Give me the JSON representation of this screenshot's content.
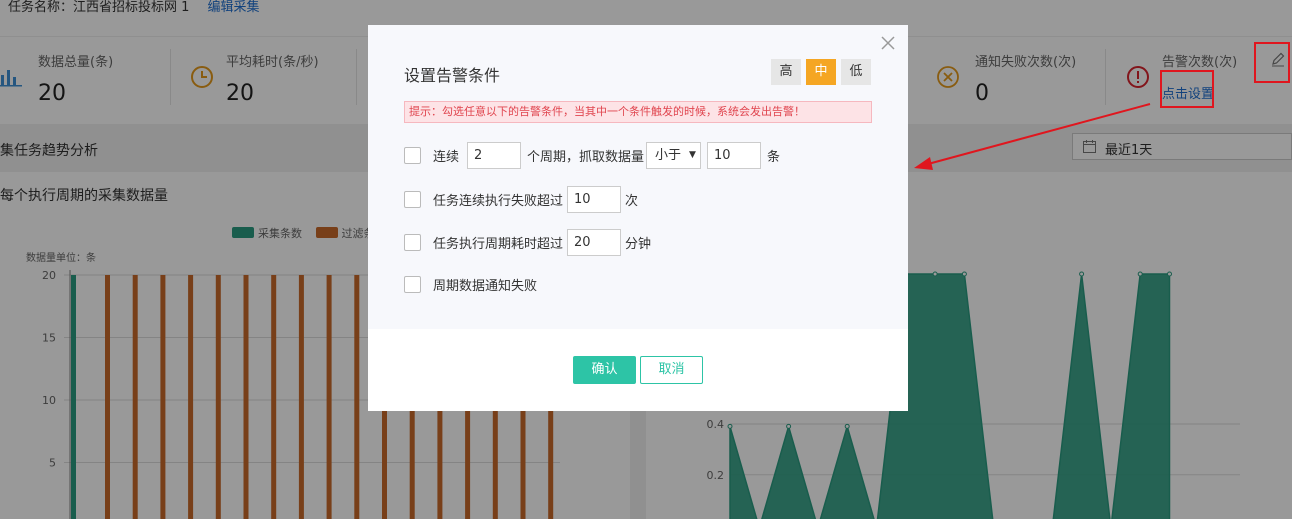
{
  "header": {
    "task_label": "任务名称：江西省招标投标网 1",
    "edit_link": "编辑采集"
  },
  "stats": {
    "total": {
      "title": "数据总量(条)",
      "value": "20"
    },
    "avg_time": {
      "title": "平均耗时(条/秒)",
      "value": "20"
    },
    "notify_fail": {
      "title": "通知失败次数(次)",
      "value": "0"
    },
    "alert": {
      "title": "告警次数(次)",
      "link": "点击设置"
    }
  },
  "section": {
    "title": "集任务趋势分析",
    "date_range": "最近1天"
  },
  "left_chart": {
    "title": "每个执行周期的采集数据量",
    "unit": "数据量单位：条",
    "legend": [
      "采集条数",
      "过滤条"
    ],
    "y_ticks": [
      "20",
      "15",
      "10",
      "5"
    ]
  },
  "right_chart": {
    "y_ticks": [
      "0.4",
      "0.2"
    ]
  },
  "chart_data": [
    {
      "type": "bar",
      "series": [
        {
          "name": "采集条数",
          "values": [
            20
          ]
        },
        {
          "name": "过滤条",
          "values": [
            20,
            20,
            20,
            20,
            20,
            20,
            20,
            20,
            20,
            20,
            20,
            20,
            20,
            20,
            20,
            20,
            20
          ]
        }
      ],
      "ylim": [
        0,
        20
      ],
      "colors": {
        "collected": "#2a9b80",
        "filtered": "#c8692a"
      }
    },
    {
      "type": "area",
      "values": [
        0.4,
        0,
        0.4,
        0,
        0.4,
        0,
        1,
        1,
        1,
        0,
        0,
        0,
        1,
        0,
        1,
        1
      ],
      "ylim": [
        0,
        1
      ],
      "color": "#2a9b80"
    }
  ],
  "modal": {
    "title": "设置告警条件",
    "levels": [
      "高",
      "中",
      "低"
    ],
    "active_level": "中",
    "tip": "提示：勾选任意以下的告警条件，当其中一个条件触发的时候，系统会发出告警！",
    "cond1": {
      "prefix": "连续",
      "periods": "2",
      "middle": "个周期，抓取数据量",
      "op": "小于",
      "amount": "10",
      "suffix": "条"
    },
    "cond2": {
      "prefix": "任务连续执行失败超过",
      "count": "10",
      "suffix": "次"
    },
    "cond3": {
      "prefix": "任务执行周期耗时超过",
      "minutes": "20",
      "suffix": "分钟"
    },
    "cond4": {
      "label": "周期数据通知失败"
    },
    "ok": "确认",
    "cancel": "取消"
  },
  "colors": {
    "accent": "#2dc4a6",
    "active_level": "#f5a623",
    "annotation": "#e0161e",
    "link": "#1f6fd1"
  }
}
